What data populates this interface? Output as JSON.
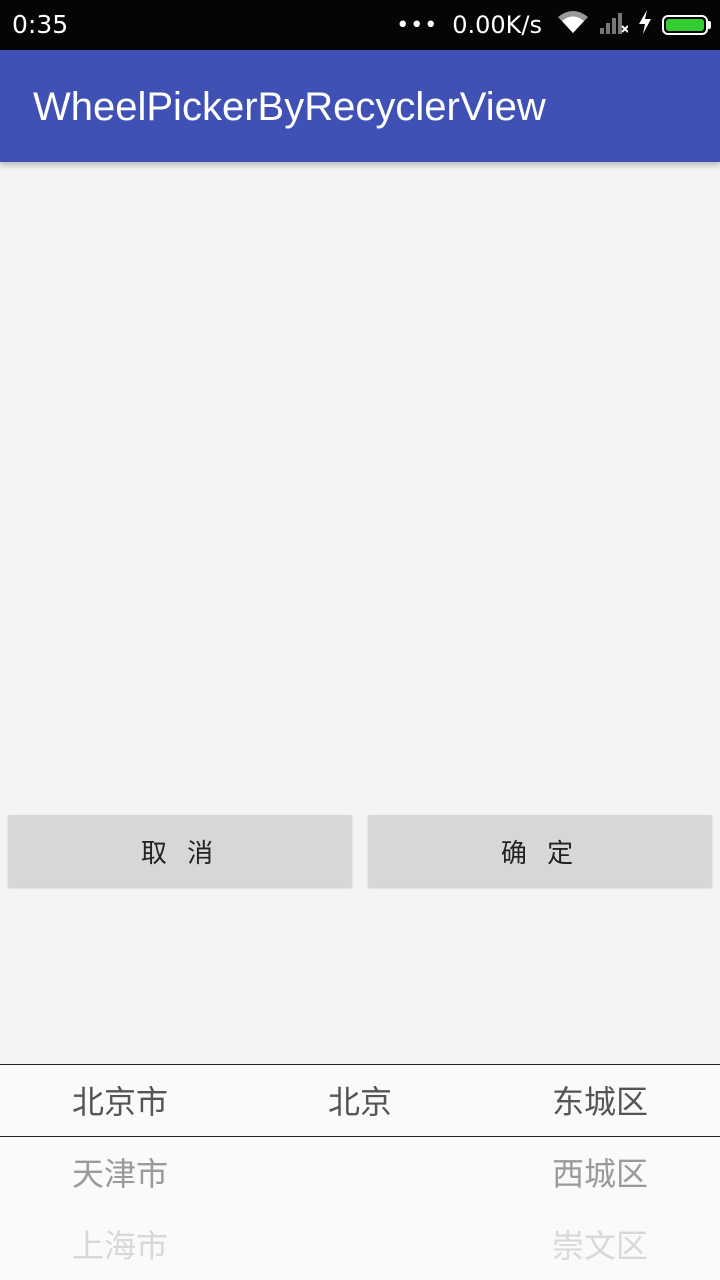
{
  "status_bar": {
    "time": "0:35",
    "dots": "•••",
    "speed": "0.00K/s",
    "icons": [
      "wifi-icon",
      "signal-icon",
      "charging-icon",
      "battery-icon"
    ],
    "battery_color": "#33cc33"
  },
  "app_bar": {
    "title": "WheelPickerByRecyclerView",
    "color": "#3f51b5"
  },
  "buttons": {
    "cancel_label": "取 消",
    "confirm_label": "确 定"
  },
  "picker": {
    "province": [
      "北京市",
      "天津市",
      "上海市"
    ],
    "city": [
      "北京"
    ],
    "district": [
      "东城区",
      "西城区",
      "崇文区"
    ]
  }
}
